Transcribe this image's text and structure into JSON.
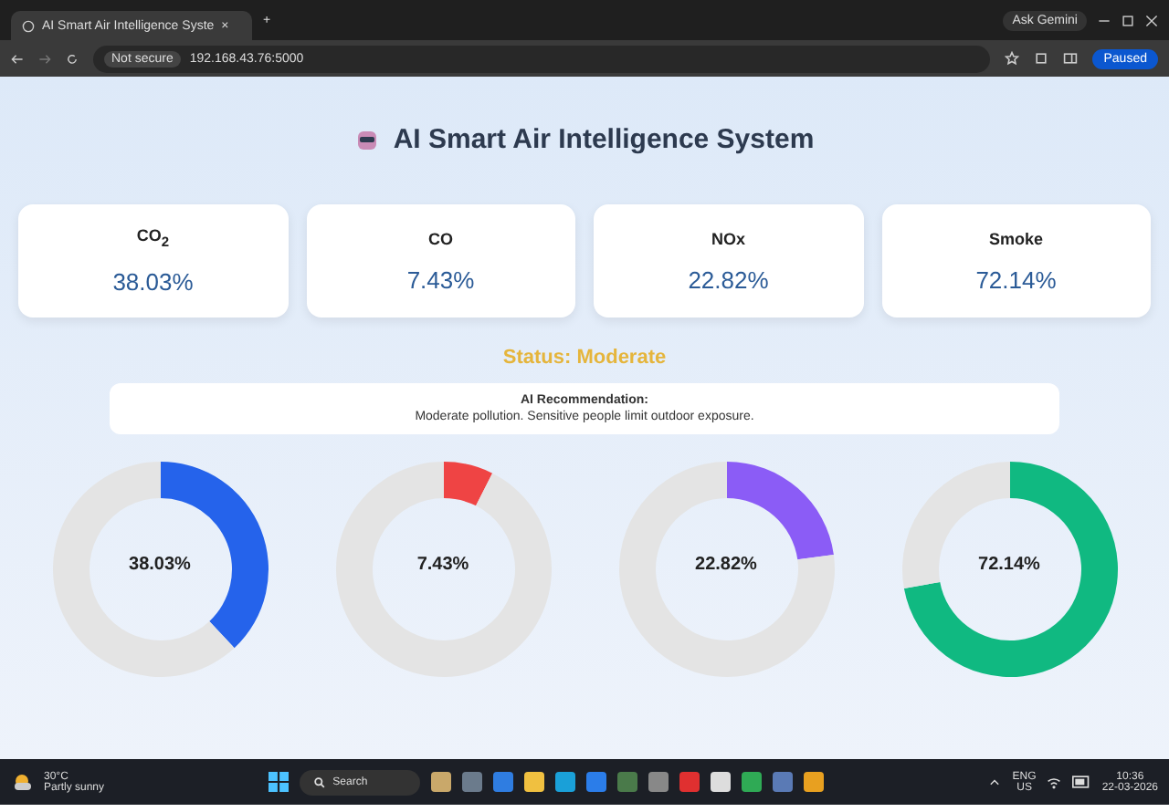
{
  "browser": {
    "tab_title": "AI Smart Air Intelligence Syste",
    "tab_close": "×",
    "new_tab": "+",
    "ask_gemini": "Ask Gemini",
    "security": "Not secure",
    "url": "192.168.43.76:5000",
    "profile": "Paused"
  },
  "title": "AI Smart Air Intelligence System",
  "cards": [
    {
      "label": "CO$_{2}$",
      "value": "38.03%"
    },
    {
      "label": "CO",
      "value": "7.43%"
    },
    {
      "label": "NOx",
      "value": "22.82%"
    },
    {
      "label": "Smoke",
      "value": "72.14%"
    }
  ],
  "status": "Status: Moderate",
  "recommendation": {
    "heading": "AI Recommendation:",
    "text": "Moderate pollution. Sensitive people limit outdoor exposure."
  },
  "gauges": [
    {
      "reading": "38.03%",
      "color": "#2563eb",
      "chart_data": {
        "type": "donut",
        "values": [
          38.03,
          61.97
        ]
      }
    },
    {
      "reading": "7.43%",
      "color": "#ef4444",
      "chart_data": {
        "type": "donut",
        "values": [
          7.43,
          92.57
        ]
      }
    },
    {
      "reading": "22.82%",
      "color": "#8b5cf6",
      "chart_data": {
        "type": "donut",
        "values": [
          22.82,
          77.18
        ]
      }
    },
    {
      "reading": "72.14%",
      "color": "#10b981",
      "chart_data": {
        "type": "donut",
        "values": [
          72.14,
          27.86
        ]
      }
    }
  ],
  "taskbar": {
    "temperature": "30°C",
    "weather": "Partly sunny",
    "search": "Search",
    "language": "ENG",
    "region": "US",
    "time": "10:36",
    "date": "22-03-2026"
  }
}
